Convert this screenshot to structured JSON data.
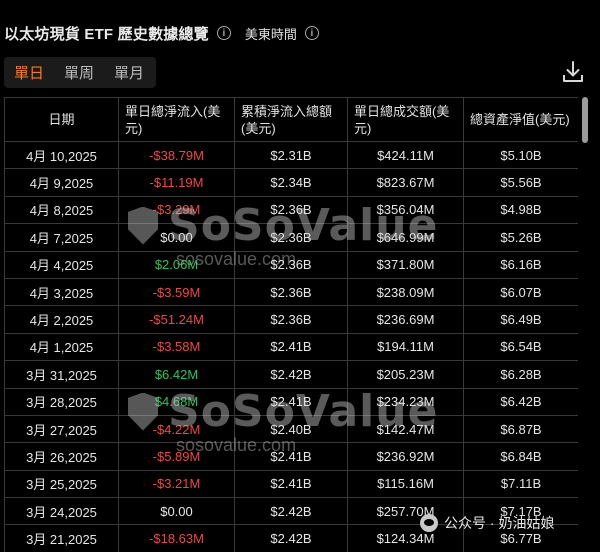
{
  "header": {
    "title": "以太坊現貨 ETF 歷史數據總覽",
    "timezone_label": "美東時間"
  },
  "tabs": [
    {
      "label": "單日",
      "active": true
    },
    {
      "label": "單周",
      "active": false
    },
    {
      "label": "單月",
      "active": false
    }
  ],
  "accent_color": "#ff7a1a",
  "status_colors": {
    "negative": "#f0483e",
    "positive": "#2bc45c"
  },
  "table": {
    "columns": [
      "日期",
      "單日總淨流入(美元)",
      "累積淨流入總額(美元)",
      "單日總成交額(美元)",
      "總資產淨值(美元)"
    ],
    "rows": [
      {
        "date": "4月 10,2025",
        "net_inflow": "-$38.79M",
        "sign": "neg",
        "cumulative": "$2.31B",
        "value_traded": "$424.11M",
        "net_assets": "$5.10B"
      },
      {
        "date": "4月 9,2025",
        "net_inflow": "-$11.19M",
        "sign": "neg",
        "cumulative": "$2.34B",
        "value_traded": "$823.67M",
        "net_assets": "$5.56B"
      },
      {
        "date": "4月 8,2025",
        "net_inflow": "-$3.29M",
        "sign": "neg",
        "cumulative": "$2.36B",
        "value_traded": "$356.04M",
        "net_assets": "$4.98B"
      },
      {
        "date": "4月 7,2025",
        "net_inflow": "$0.00",
        "sign": "zero",
        "cumulative": "$2.36B",
        "value_traded": "$646.99M",
        "net_assets": "$5.26B"
      },
      {
        "date": "4月 4,2025",
        "net_inflow": "$2.06M",
        "sign": "pos",
        "cumulative": "$2.36B",
        "value_traded": "$371.80M",
        "net_assets": "$6.16B"
      },
      {
        "date": "4月 3,2025",
        "net_inflow": "-$3.59M",
        "sign": "neg",
        "cumulative": "$2.36B",
        "value_traded": "$238.09M",
        "net_assets": "$6.07B"
      },
      {
        "date": "4月 2,2025",
        "net_inflow": "-$51.24M",
        "sign": "neg",
        "cumulative": "$2.36B",
        "value_traded": "$236.69M",
        "net_assets": "$6.49B"
      },
      {
        "date": "4月 1,2025",
        "net_inflow": "-$3.58M",
        "sign": "neg",
        "cumulative": "$2.41B",
        "value_traded": "$194.11M",
        "net_assets": "$6.54B"
      },
      {
        "date": "3月 31,2025",
        "net_inflow": "$6.42M",
        "sign": "pos",
        "cumulative": "$2.42B",
        "value_traded": "$205.23M",
        "net_assets": "$6.28B"
      },
      {
        "date": "3月 28,2025",
        "net_inflow": "$4.68M",
        "sign": "pos",
        "cumulative": "$2.41B",
        "value_traded": "$234.23M",
        "net_assets": "$6.42B"
      },
      {
        "date": "3月 27,2025",
        "net_inflow": "-$4.22M",
        "sign": "neg",
        "cumulative": "$2.40B",
        "value_traded": "$142.47M",
        "net_assets": "$6.87B"
      },
      {
        "date": "3月 26,2025",
        "net_inflow": "-$5.89M",
        "sign": "neg",
        "cumulative": "$2.41B",
        "value_traded": "$236.92M",
        "net_assets": "$6.84B"
      },
      {
        "date": "3月 25,2025",
        "net_inflow": "-$3.21M",
        "sign": "neg",
        "cumulative": "$2.41B",
        "value_traded": "$115.16M",
        "net_assets": "$7.11B"
      },
      {
        "date": "3月 24,2025",
        "net_inflow": "$0.00",
        "sign": "zero",
        "cumulative": "$2.42B",
        "value_traded": "$257.70M",
        "net_assets": "$7.17B"
      },
      {
        "date": "3月 21,2025",
        "net_inflow": "-$18.63M",
        "sign": "neg",
        "cumulative": "$2.42B",
        "value_traded": "$124.34M",
        "net_assets": "$6.77B"
      }
    ]
  },
  "watermark": {
    "brand": "SoSoValue",
    "url": "sosovalue.com"
  },
  "credit": {
    "text": "公众号 · 奶油姑娘"
  },
  "icons": {
    "info": "info-icon",
    "download": "download-icon",
    "watermark_logo": "sosovalue-logo-icon",
    "credit": "wechat-icon"
  }
}
